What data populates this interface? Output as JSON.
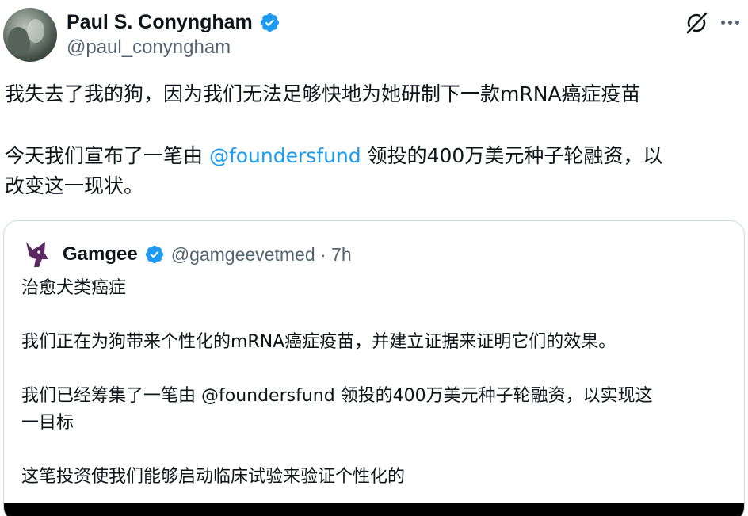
{
  "author": {
    "display_name": "Paul S. Conyngham",
    "handle": "@paul_conyngham"
  },
  "actions": {
    "grok_icon": "grok-icon",
    "more_icon": "more-horizontal-icon"
  },
  "tweet": {
    "line1": "我失去了我的狗，因为我们无法足够快地为她研制下一款mRNA癌症疫苗",
    "line2_before": "今天我们宣布了一笔由 ",
    "line2_mention": "@foundersfund",
    "line2_after": " 领投的400万美元种子轮融资，以",
    "line3": "改变这一现状。"
  },
  "quote": {
    "display_name": "Gamgee",
    "handle_time": "@gamgeevetmed · 7h",
    "p1": "治愈犬类癌症",
    "p2": "我们正在为狗带来个性化的mRNA癌症疫苗，并建立证据来证明它们的效果。",
    "p3_line1": "我们已经筹集了一笔由 @foundersfund 领投的400万美元种子轮融资，以实现这",
    "p3_line2": "一目标",
    "p4": "这笔投资使我们能够启动临床试验来验证个性化的"
  },
  "colors": {
    "accent": "#1d9bf0",
    "secondary_text": "#536471",
    "border": "#cfd9de"
  }
}
